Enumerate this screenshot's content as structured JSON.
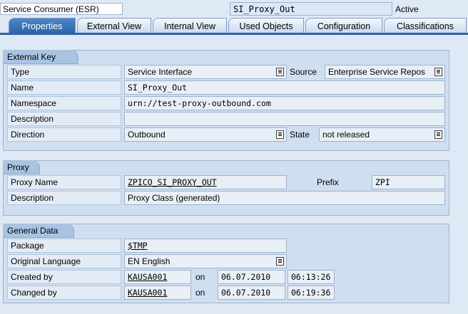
{
  "header": {
    "object_type": "Service Consumer (ESR)",
    "object_name": "SI_Proxy_Out",
    "status": "Active"
  },
  "tabs": [
    "Properties",
    "External View",
    "Internal View",
    "Used Objects",
    "Configuration",
    "Classifications"
  ],
  "external_key": {
    "title": "External Key",
    "type_label": "Type",
    "type_value": "Service Interface",
    "source_label": "Source",
    "source_value": "Enterprise Service Repos",
    "name_label": "Name",
    "name_value": "SI_Proxy_Out",
    "namespace_label": "Namespace",
    "namespace_value": "urn://test-proxy-outbound.com",
    "description_label": "Description",
    "description_value": "",
    "direction_label": "Direction",
    "direction_value": "Outbound",
    "state_label": "State",
    "state_value": "not released"
  },
  "proxy": {
    "title": "Proxy",
    "name_label": "Proxy Name",
    "name_value": "ZPICO_SI_PROXY_OUT",
    "prefix_label": "Prefix",
    "prefix_value": "ZPI",
    "description_label": "Description",
    "description_value": "Proxy Class (generated)"
  },
  "general": {
    "title": "General Data",
    "package_label": "Package",
    "package_value": "$TMP",
    "language_label": "Original Language",
    "language_value": "EN English",
    "created_label": "Created by",
    "created_user": "KAUSA001",
    "created_on": "on",
    "created_date": "06.07.2010",
    "created_time": "06:13:26",
    "changed_label": "Changed by",
    "changed_user": "KAUSA001",
    "changed_on": "on",
    "changed_date": "06.07.2010",
    "changed_time": "06:19:36"
  },
  "colors": {
    "active_tab": "#2c64a8",
    "background": "#dfe9f5",
    "group": "#d0dff0"
  }
}
